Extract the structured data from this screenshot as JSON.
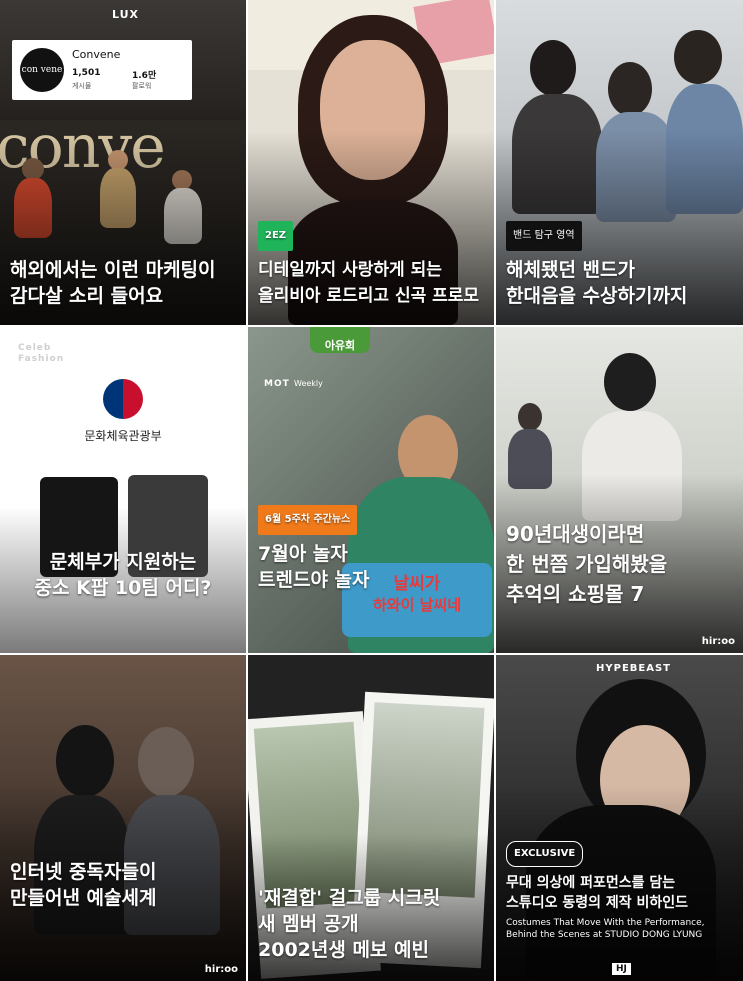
{
  "tiles": [
    {
      "brand": "LUX",
      "profile": {
        "name": "Convene",
        "logo": "con vene",
        "posts_count": "1,501",
        "posts_label": "게시물",
        "followers_count": "1.6만",
        "followers_label": "팔로워"
      },
      "building_text": "conve",
      "caption": [
        "해외에서는 이런 마케팅이",
        "감다살 소리 들어요"
      ]
    },
    {
      "tag": "2EZ",
      "caption": [
        "디테일까지 사랑하게 되는",
        "올리비아 로드리고 신곡 프로모"
      ]
    },
    {
      "tag": "밴드 탐구 영역",
      "caption": [
        "해체됐던 밴드가",
        "한대음을 수상하기까지"
      ]
    },
    {
      "brand": "Celeb Fashion",
      "ministry": "문화체육관광부",
      "caption": [
        "문체부가 지원하는",
        "중소 K팝 10팀 어디?"
      ]
    },
    {
      "brand_left": "MOT",
      "brand_right": "Weekly",
      "sign_top": "아유회",
      "tag": "6월 5주차 주간뉴스",
      "caption": [
        "7월아 놀자",
        "트렌드야 놀자"
      ],
      "sign_bottom": [
        "날씨가",
        "하와이 날씨네"
      ]
    },
    {
      "caption": [
        "90년대생이라면",
        "한 번쯤 가입해봤을",
        "추억의 쇼핑몰 7"
      ],
      "corner_logo": "hir:oo"
    },
    {
      "caption": [
        "인터넷 중독자들이",
        "만들어낸 예술세계"
      ],
      "corner_logo": "hir:oo"
    },
    {
      "caption": [
        "'재결합' 걸그룹 시크릿",
        "새 멤버 공개",
        "2002년생 메보 예빈"
      ]
    },
    {
      "brand": "HYPEBEAST",
      "tag": "EXCLUSIVE",
      "caption": [
        "무대 의상에 퍼포먼스를 담는",
        "스튜디오 동령의 제작 비하인드"
      ],
      "subcaption": [
        "Costumes That Move With the Performance,",
        "Behind the Scenes at STUDIO DONG LYUNG"
      ],
      "corner_logo": "HJ"
    }
  ],
  "colors": {
    "tag_green": "#1fb45a",
    "tag_orange": "#f07a1a",
    "tag_black": "#111111"
  }
}
